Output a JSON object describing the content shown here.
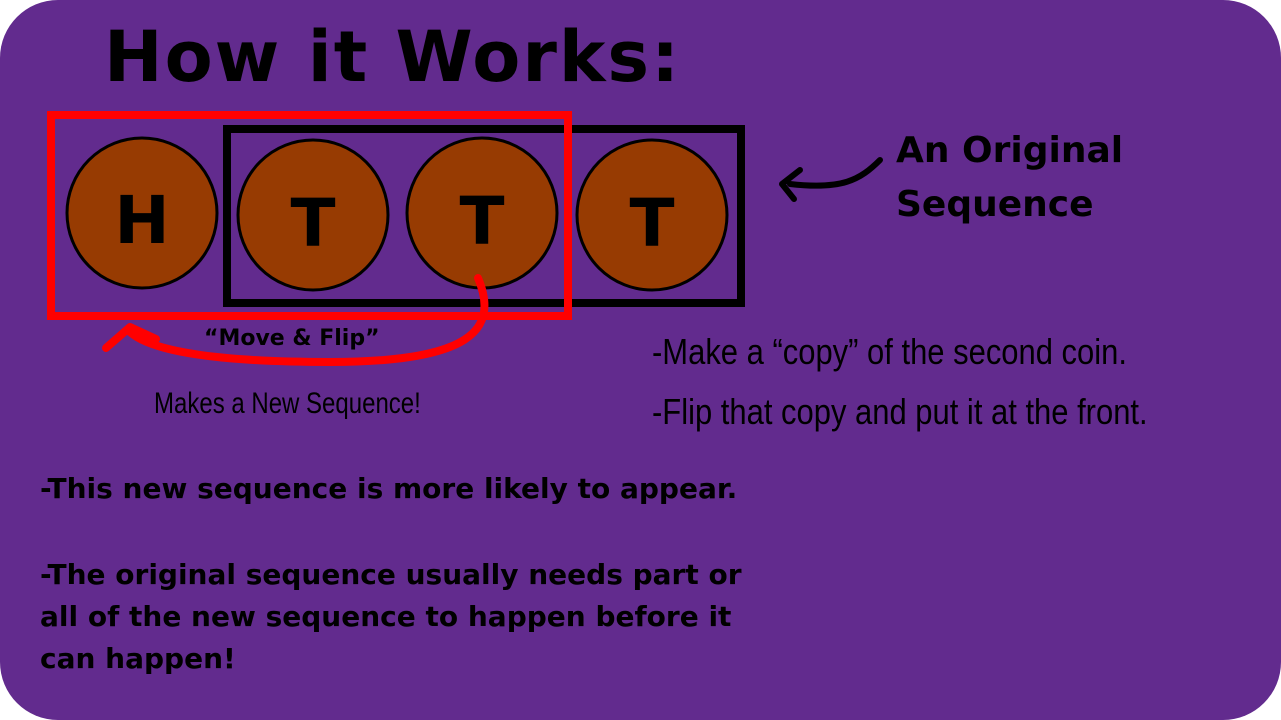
{
  "title": "How it Works:",
  "coins": [
    "H",
    "T",
    "T",
    "T"
  ],
  "labels": {
    "original_line1": "An Original",
    "original_line2": "Sequence",
    "move_flip": "“Move & Flip”",
    "makes_new": "Makes a New Sequence!"
  },
  "steps": [
    "-Make a “copy” of the second coin.",
    "-Flip that copy and put it at the front."
  ],
  "notes": [
    "-This new sequence is more likely to appear.",
    "-The original sequence usually needs part or all of the new sequence to happen before it can happen!"
  ],
  "colors": {
    "background": "#622b8e",
    "coin_fill": "#973b02",
    "new_sequence_box": "#ff0000",
    "original_sequence_box": "#000000",
    "text": "#000000"
  }
}
